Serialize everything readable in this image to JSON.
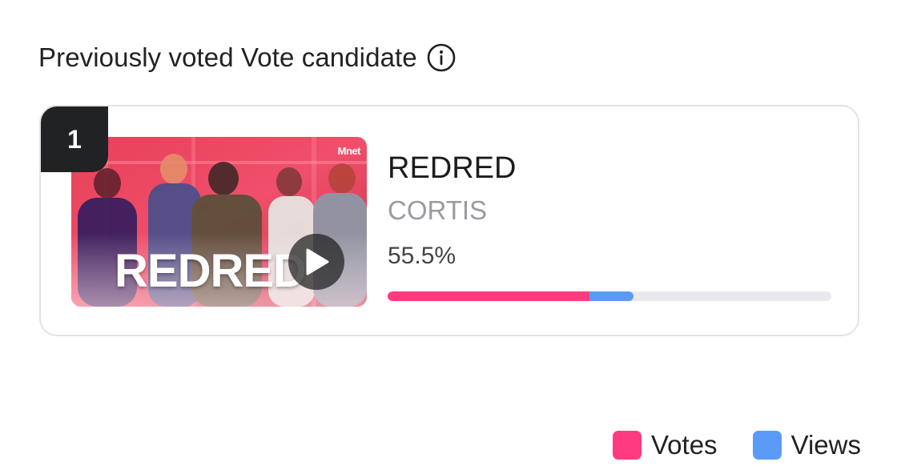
{
  "section": {
    "title": "Previously voted Vote candidate",
    "info_icon": "info-circle-icon"
  },
  "candidate": {
    "rank": "1",
    "thumbnail": {
      "overlay_title": "REDRED",
      "channel_logo": "Mnet",
      "play_icon": "play-icon"
    },
    "song_title": "REDRED",
    "artist": "CORTIS",
    "percent_label": "55.5%",
    "progress": {
      "total_percent": 55.5,
      "votes_percent": 45.5,
      "views_percent": 10.0
    }
  },
  "legend": [
    {
      "label": "Votes",
      "color": "#ff3b7f"
    },
    {
      "label": "Views",
      "color": "#5b9bf8"
    }
  ],
  "colors": {
    "votes": "#ff3b7f",
    "views": "#5b9bf8",
    "track": "#e9e9ed",
    "badge": "#202224"
  }
}
